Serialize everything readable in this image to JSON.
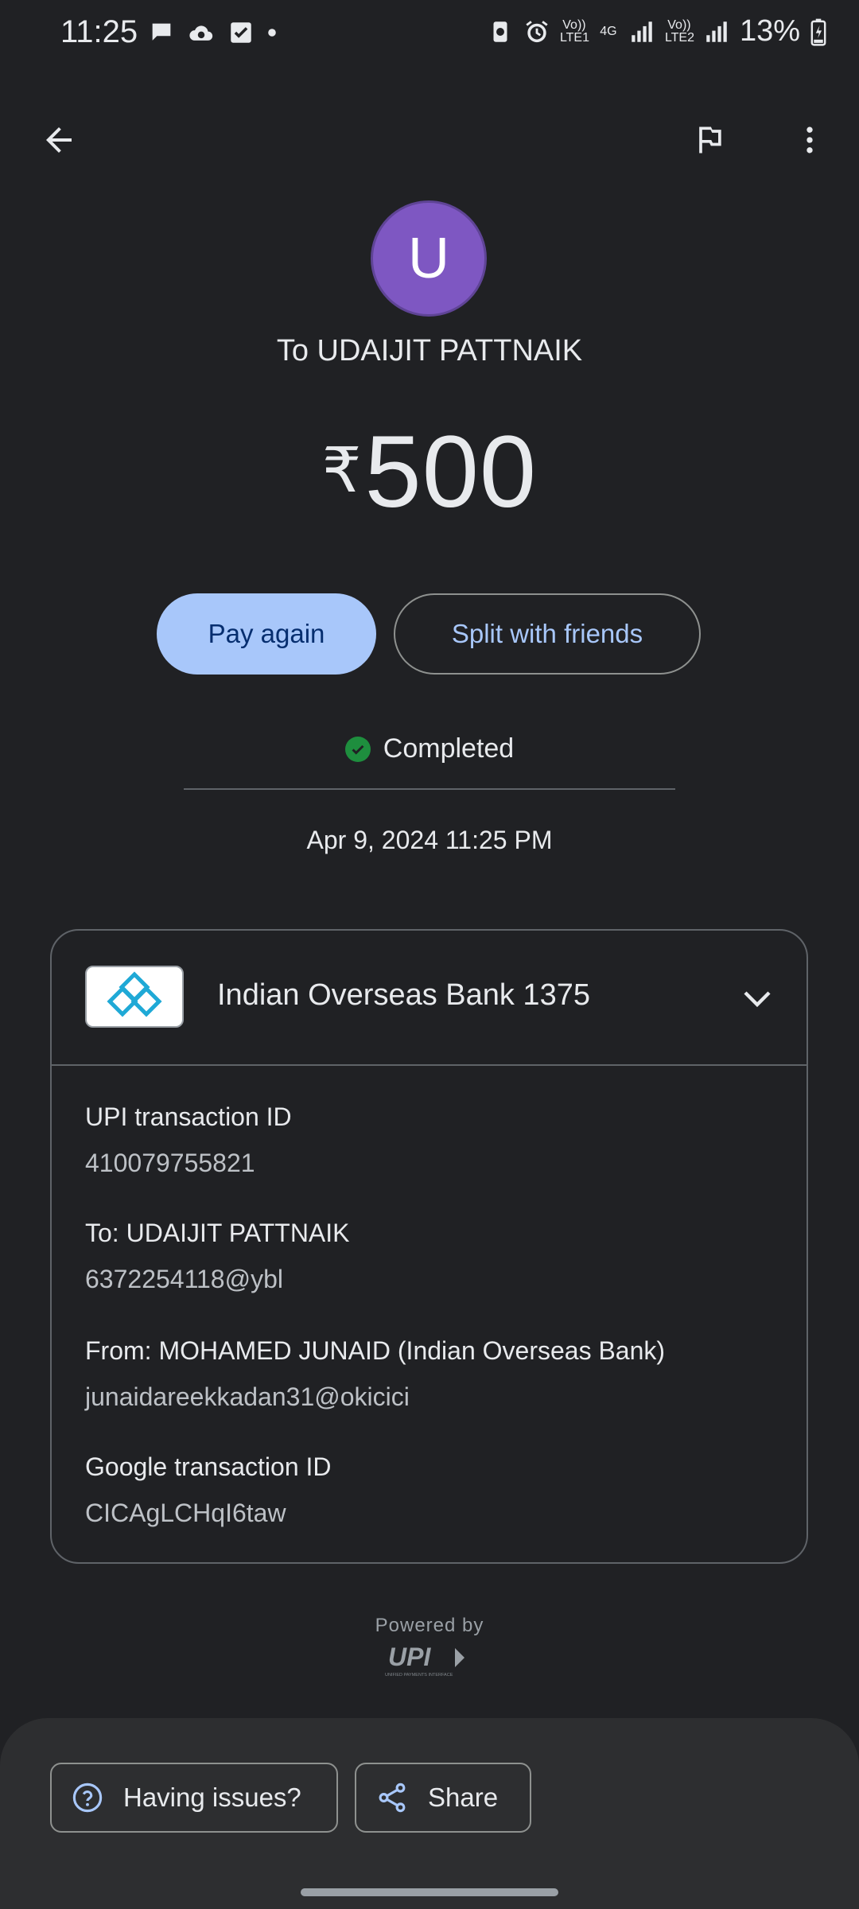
{
  "status_bar": {
    "time": "11:25",
    "sim1": "Vo)) LTE1",
    "network": "4G",
    "sim2": "Vo)) LTE2",
    "battery": "13%"
  },
  "toolbar": {
    "back_icon": "arrow-back-icon",
    "report_icon": "flag-icon",
    "more_icon": "more-vert-icon"
  },
  "payee": {
    "avatar_letter": "U",
    "avatar_color": "#7e57c2",
    "to_text": "To UDAIJIT PATTNAIK"
  },
  "amount": {
    "currency": "₹",
    "value": "500"
  },
  "actions": {
    "pay_again": "Pay again",
    "split": "Split with friends"
  },
  "transaction_status": {
    "label": "Completed",
    "color": "#1e8e3e"
  },
  "datetime": "Apr 9, 2024 11:25 PM",
  "card": {
    "bank_name": "Indian Overseas Bank 1375",
    "details": [
      {
        "label": "UPI transaction ID",
        "value": "410079755821"
      },
      {
        "label": "To: UDAIJIT PATTNAIK",
        "value": "6372254118@ybl"
      },
      {
        "label": "From: MOHAMED  JUNAID (Indian Overseas Bank)",
        "value": "junaidareekkadan31@okicici"
      },
      {
        "label": "Google transaction ID",
        "value": "CICAgLCHqI6taw"
      }
    ]
  },
  "footer": {
    "powered_by": "Powered by",
    "upi_logo": "UPI",
    "upi_subtitle": "UNIFIED PAYMENTS INTERFACE"
  },
  "bottom_actions": {
    "issues": "Having issues?",
    "share": "Share"
  }
}
